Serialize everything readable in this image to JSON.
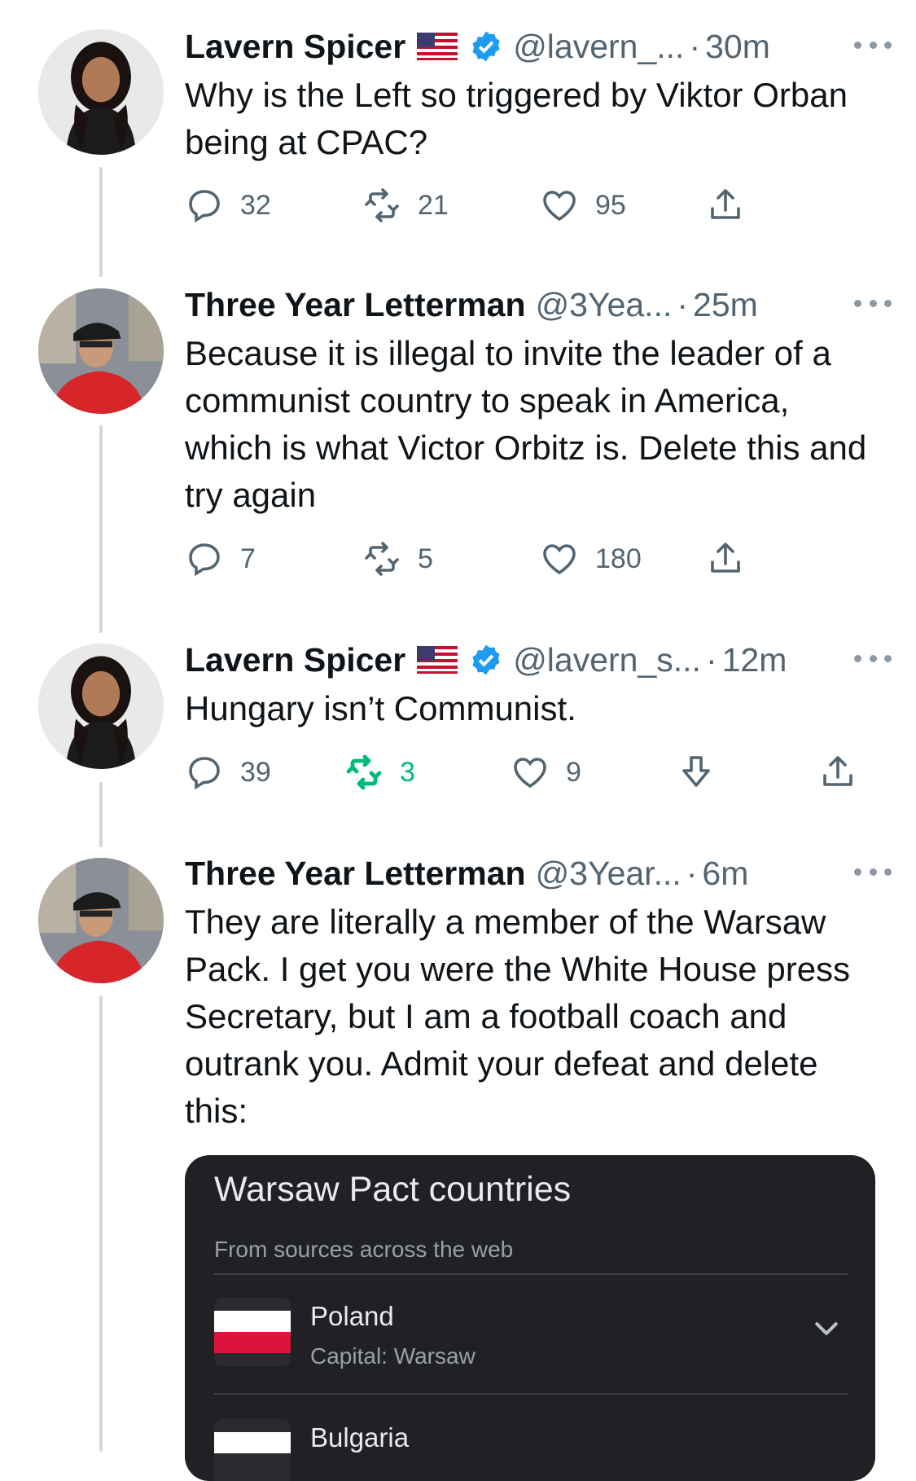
{
  "tweets": [
    {
      "name": "Lavern Spicer",
      "handle": "@lavern_...",
      "time": "30m",
      "text": "Why is the Left so triggered by Viktor Orban being at CPAC?",
      "replies": "32",
      "retweets": "21",
      "likes": "95"
    },
    {
      "name": "Three Year Letterman",
      "handle": "@3Yea...",
      "time": "25m",
      "text": "Because it is illegal to invite the leader of a communist country to speak in America, which is what Victor Orbitz is. Delete this and try again",
      "replies": "7",
      "retweets": "5",
      "likes": "180"
    },
    {
      "name": "Lavern Spicer",
      "handle": "@lavern_s...",
      "time": "12m",
      "text": "Hungary isn’t Communist.",
      "replies": "39",
      "retweets": "3",
      "likes": "9"
    },
    {
      "name": "Three Year Letterman",
      "handle": "@3Year...",
      "time": "6m",
      "text": "They are literally a member of the Warsaw Pack. I get you were the White House press Secretary, but I am a football coach and outrank you. Admit your defeat and delete this:"
    }
  ],
  "separator": "·",
  "card": {
    "title": "Warsaw Pact countries",
    "subtitle": "From sources across the web",
    "rows": [
      {
        "name": "Poland",
        "capital": "Capital: Warsaw"
      },
      {
        "name": "Bulgaria"
      }
    ]
  },
  "colors": {
    "verified": "#1d9bf0",
    "retweet_active": "#00ba7c",
    "muted": "#536471",
    "card_bg": "#202124"
  },
  "icons": [
    "reply-icon",
    "retweet-icon",
    "like-icon",
    "share-icon",
    "downvote-icon",
    "more-icon",
    "verified-icon",
    "us-flag-icon",
    "chevron-down-icon"
  ]
}
